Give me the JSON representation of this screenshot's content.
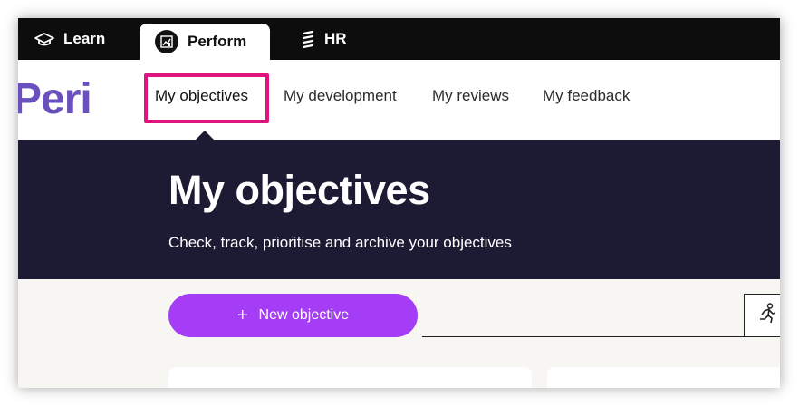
{
  "appbar": {
    "tabs": [
      {
        "label": "Learn",
        "icon": "graduation-cap-icon"
      },
      {
        "label": "Perform",
        "icon": "chart-icon",
        "active": true
      },
      {
        "label": "HR",
        "icon": "hr-icon"
      }
    ]
  },
  "subnav": {
    "logo": "Peri",
    "items": [
      "My objectives",
      "My development",
      "My reviews",
      "My feedback"
    ],
    "active_index": 0
  },
  "hero": {
    "title": "My objectives",
    "subtitle": "Check, track, prioritise and archive your objectives"
  },
  "actions": {
    "new_objective_label": "New objective",
    "filter_icon": "running-person-icon"
  },
  "colors": {
    "appbar_bg": "#0d0d0d",
    "hero_bg": "#1d1b33",
    "primary_button": "#a43df5",
    "logo": "#6a4fbf",
    "highlight": "#e0147f"
  }
}
